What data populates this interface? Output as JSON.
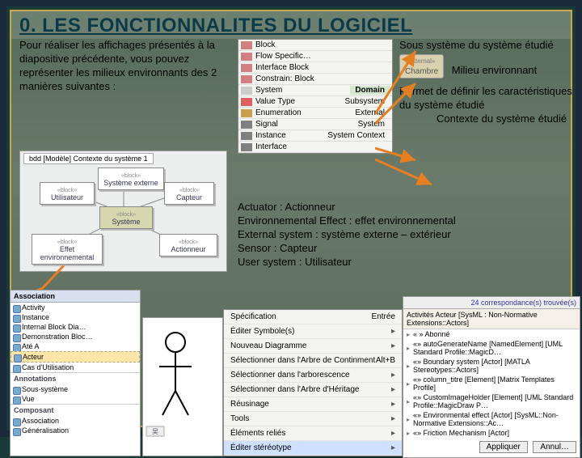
{
  "title": "0. LES FONCTIONNALITES DU LOGICIEL",
  "intro": "Pour réaliser les affichages présentés à la diapositive précédente, vous pouvez représenter les milieux environnants des 2 manières suivantes :",
  "right": {
    "l1": "Sous système du système étudié",
    "chip_stereo": "«external»",
    "chip": "Chambre",
    "l2": "Milieu environnant",
    "l3": "Permet de définir les caractéristiques du système étudié",
    "l4": "Contexte du système étudié"
  },
  "palette": {
    "items1": [
      {
        "label": "Block",
        "color": "#d08080"
      },
      {
        "label": "Flow Specific…",
        "color": "#d08080"
      },
      {
        "label": "Interface Block",
        "color": "#d08080"
      },
      {
        "label": "Constrain: Block",
        "color": "#d08080"
      },
      {
        "label": "System",
        "color": "#ccc"
      },
      {
        "label": "Value Type",
        "color": "#e06060"
      },
      {
        "label": "Enumeration",
        "color": "#c8a050"
      },
      {
        "label": "Signal",
        "color": "#808080"
      },
      {
        "label": "Instance",
        "color": "#808080"
      },
      {
        "label": "Interface",
        "color": "#808080"
      }
    ],
    "section_green": "Domain",
    "items_green": [
      "Subsystem",
      "External",
      "System",
      "System Context"
    ],
    "section_blue": "…"
  },
  "glossary": {
    "l1": "Actuator : Actionneur",
    "l2": "Environnemental Effect : effet environnemental",
    "l3": "External system : système externe – extérieur",
    "l4": "Sensor : Capteur",
    "l5": "User system : Utilisateur"
  },
  "diagram": {
    "tab": "bdd [Modèle] Contexte du système 1",
    "utilisateur": "Utilisateur",
    "systeme_externe": "Système externe",
    "systeme": "Système",
    "capteur": "Capteur",
    "effet_env": "Effet environnemental",
    "actionneur": "Actionneur",
    "block_stereo": "«block»"
  },
  "panel_left": {
    "head": "Association",
    "items": [
      "Activity",
      "Instance",
      "Internal Block Dia…",
      "Demonstration Bloc…",
      "Até A"
    ],
    "selected": "Acteur",
    "items2": [
      "Cas d'Utilisation"
    ],
    "grp1": "Annotations",
    "items3": [
      "Sous-système",
      "Vue"
    ],
    "grp2": "Composant",
    "items4": [
      "Association",
      "Généralisation"
    ]
  },
  "context_menu": {
    "items": [
      {
        "label": "Spécification",
        "shortcut": "Entrée"
      },
      {
        "label": "Éditer Symbole(s)",
        "arrow": true
      },
      {
        "label": "Nouveau Diagramme",
        "arrow": true
      },
      {
        "label": "Sélectionner dans l'Arbre de Continment",
        "shortcut": "Alt+B"
      },
      {
        "label": "Sélectionner dans l'arborescence",
        "arrow": true
      },
      {
        "label": "Sélectionner dans l'Arbre d'Héritage",
        "arrow": true
      },
      {
        "label": "Réusinage",
        "arrow": true
      },
      {
        "label": "Tools",
        "arrow": true
      },
      {
        "label": "Éléments reliés",
        "arrow": true
      },
      {
        "label": "Éditer stéréotype",
        "arrow": true,
        "highlight": true
      }
    ]
  },
  "panel_right": {
    "head": "24 correspondance(s) trouvée(s)",
    "bar": "Activités   Acteur   [SysML : Non-Normative Extensions::Actors]",
    "rows": [
      "« » Abonné",
      "«» autoGenerateName [NamedElement] [UML Standard Profile::MagicD…",
      "«» Boundary system [Actor] [MATLA Stereotypes::Actors]",
      "«» column_titre [Element] [Matrix Templates Profile]",
      "«» CustomImageHolder [Element] [UML Standard Profile::MagicDraw P…",
      "«» Environmental effect [Actor] [SysML::Non-Normative Extensions::Ac…",
      "«» Friction Mechanism [Actor]"
    ],
    "btn1": "Appliquer",
    "btn2": "Annul…"
  }
}
